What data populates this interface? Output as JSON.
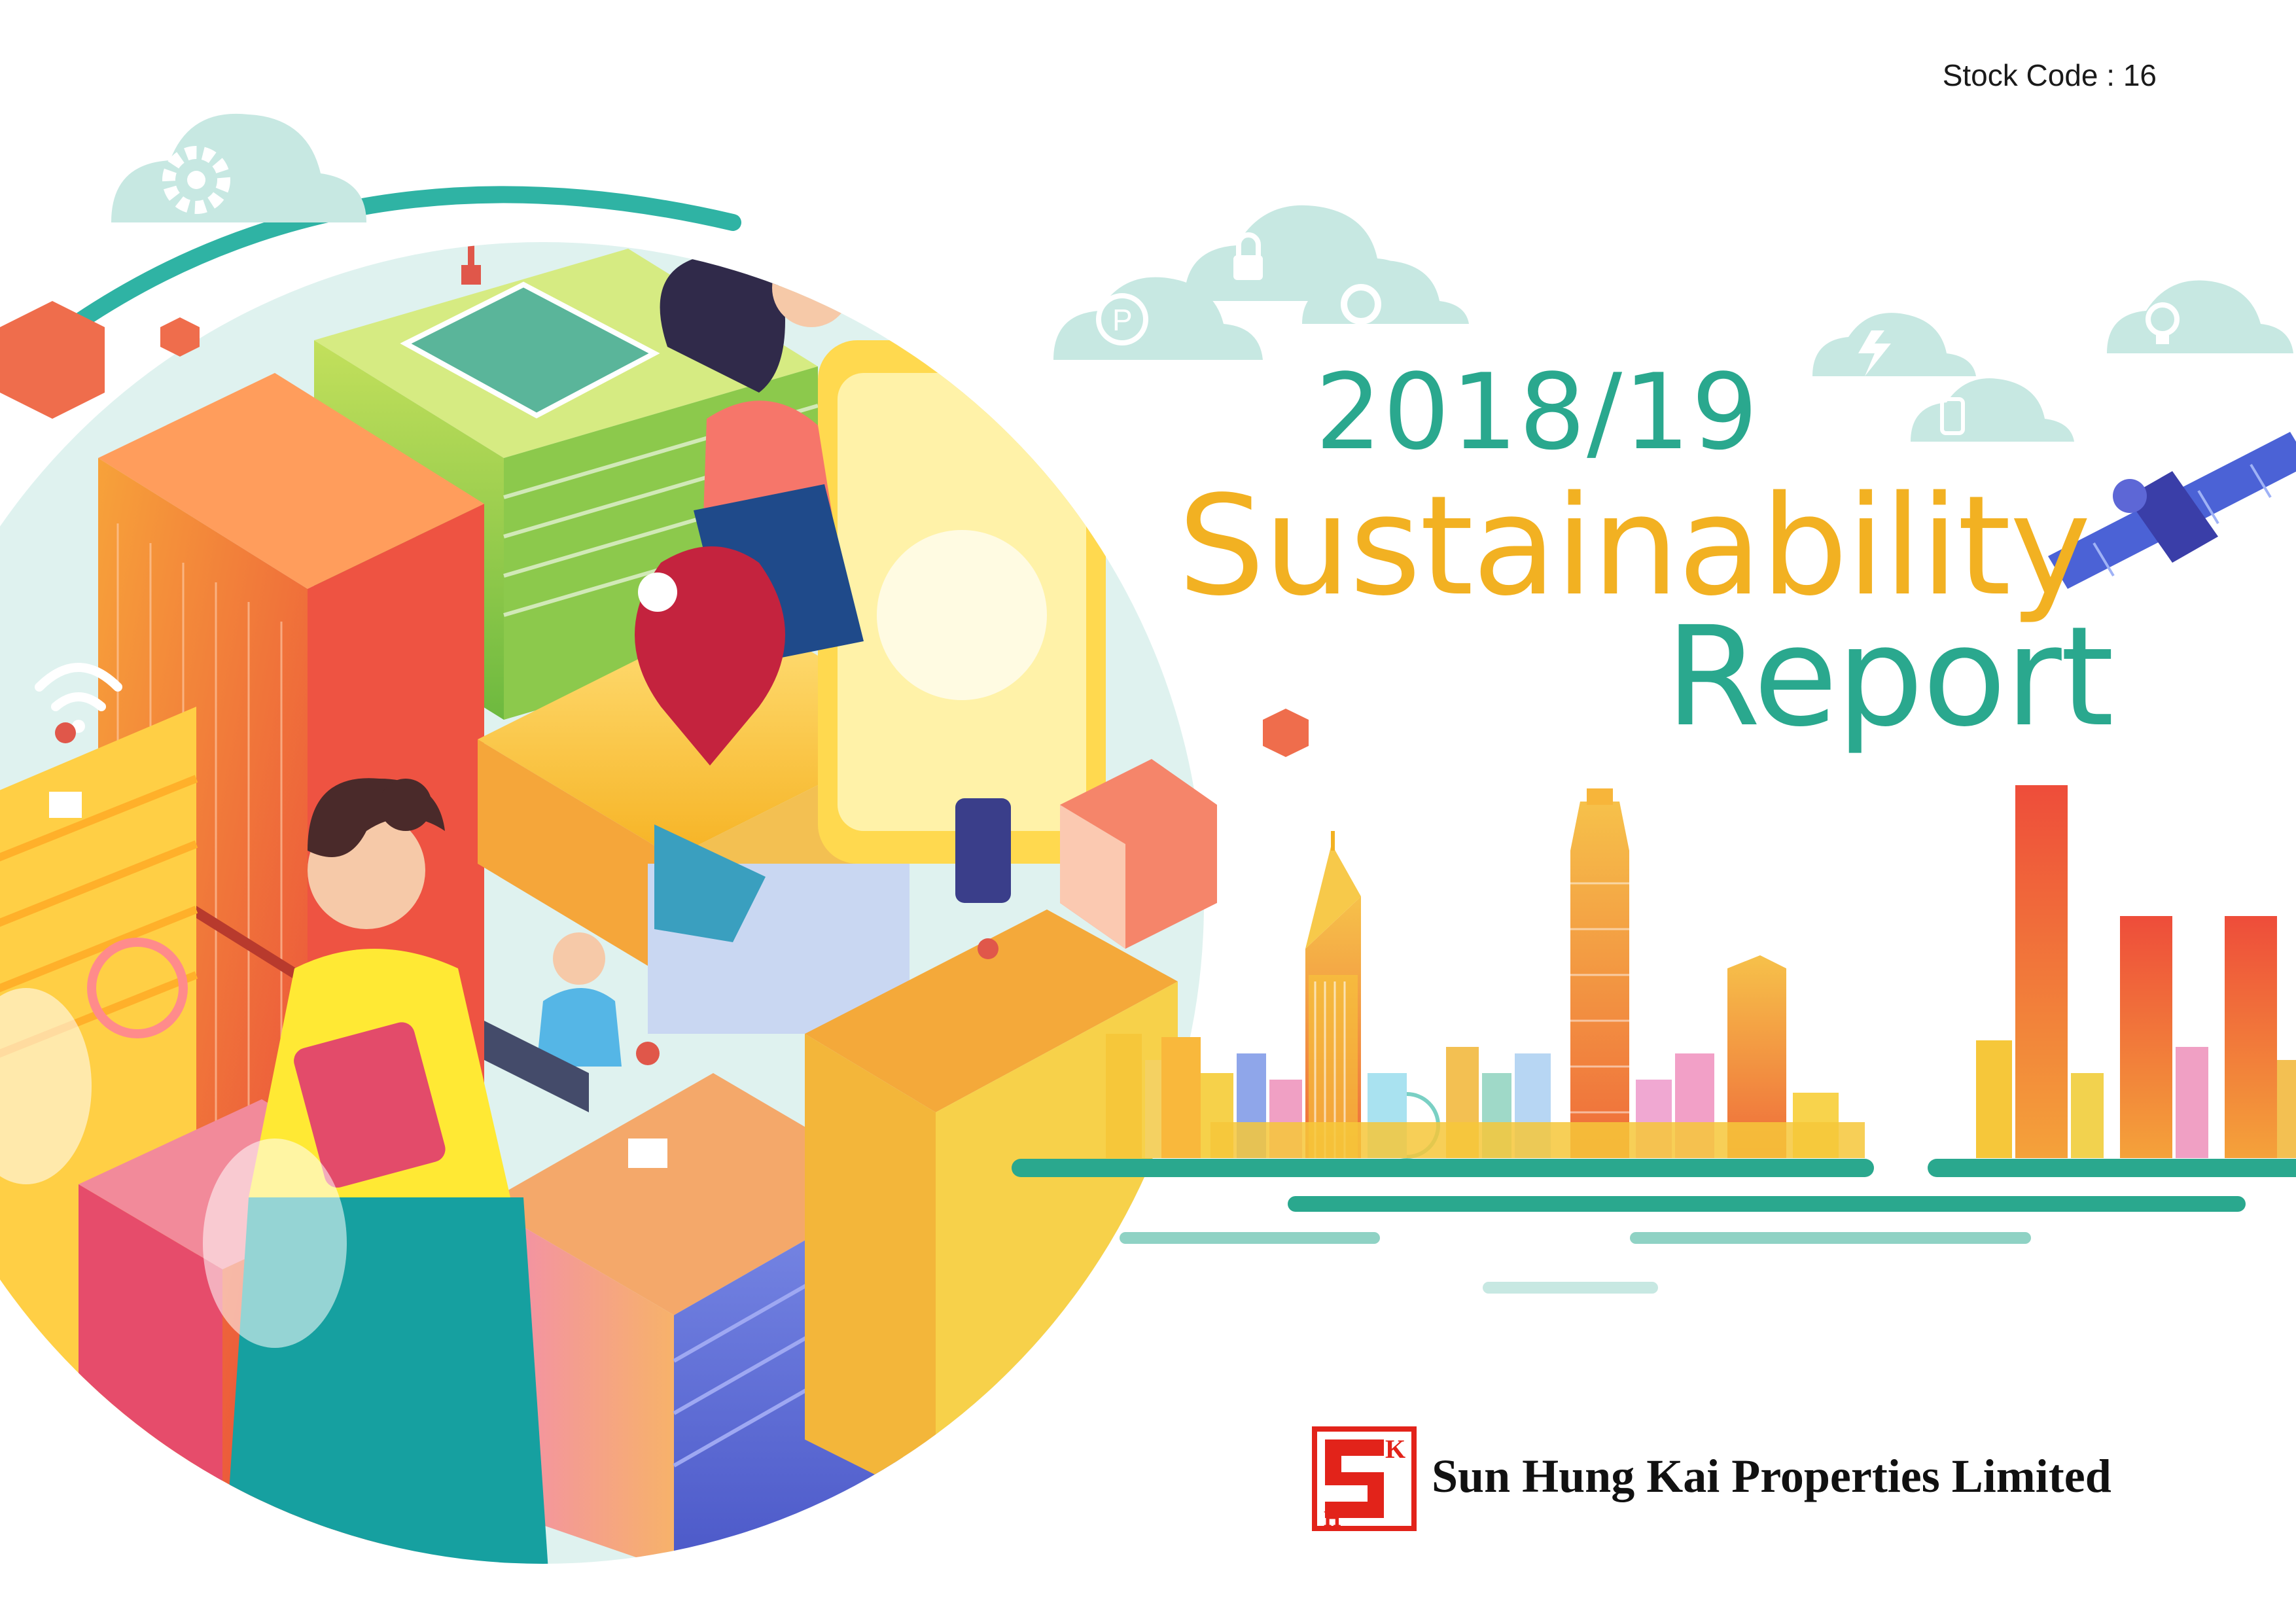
{
  "cover": {
    "stock_code": "Stock Code : 16",
    "year": "2018/19",
    "title_line1": "Sustainability",
    "title_line2": "Report",
    "company_name": "Sun Hung Kai Properties Limited"
  },
  "logo": {
    "letters": [
      "S",
      "K",
      "H"
    ],
    "color": "#e2231a"
  },
  "icons": [
    "gear-icon",
    "lock-icon",
    "fan-icon",
    "parking-icon",
    "lightning-icon",
    "lightbulb-icon",
    "phone-icon",
    "wifi-icon",
    "location-pin-icon",
    "satellite-icon"
  ],
  "colors": {
    "teal": "#2aa88e",
    "yellow": "#f2b122",
    "red": "#e2231a",
    "cloud": "#bfe4dd"
  }
}
